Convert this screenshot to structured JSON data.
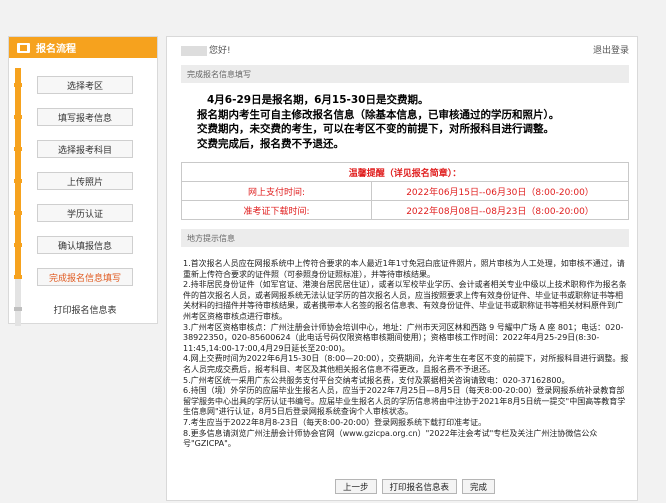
{
  "sidebar": {
    "title": "报名流程",
    "steps": [
      {
        "label": "选择考区"
      },
      {
        "label": "填写报考信息"
      },
      {
        "label": "选择报考科目"
      },
      {
        "label": "上传照片"
      },
      {
        "label": "学历认证"
      },
      {
        "label": "确认填报信息"
      },
      {
        "label": "完成报名信息填写"
      },
      {
        "label": "打印报名信息表"
      }
    ]
  },
  "header": {
    "greeting": "您好!",
    "logout": "退出登录"
  },
  "section1": {
    "title": "完成报名信息填写"
  },
  "notice": {
    "line1": "4月6-29日是报名期，6月15-30日是交费期。",
    "line2": "报名期内考生可自主修改报名信息（除基本信息，已审核通过的学历和照片）。",
    "line3": "交费期内，未交费的考生，可以在考区不变的前提下，对所报科目进行调整。",
    "line4": "交费完成后，报名费不予退还。"
  },
  "info_table": {
    "title": "温馨提醒（详见报名简章）：",
    "rows": [
      {
        "label": "网上支付时间:",
        "value": "2022年06月15日--06月30日（8:00-20:00）"
      },
      {
        "label": "准考证下载时间:",
        "value": "2022年08月08日--08月23日（8:00-20:00）"
      }
    ]
  },
  "section2": {
    "title": "地方提示信息"
  },
  "details": [
    "1.首次报名人员应在网报系统中上传符合要求的本人最近1年1寸免冠白底证件照片，照片审核为人工处理，如审核不通过，请重新上传符合要求的证件照（可参照身份证照标准），并等待审核结果。",
    "2.持非居民身份证件（如军官证、港澳台居民居住证），或者以军校毕业学历、会计或者相关专业中级以上技术职称作为报名条件的首次报名人员，或者网报系统无法认证学历的首次报名人员，应当按照要求上传有效身份证件、毕业证书或职称证书等相关材料的扫描件并等待审核结果，或者携带本人名签的报名信息表、有效身份证件、毕业证书或职称证书等相关材料原件到广州考区资格审核点进行审核。",
    "3.广州考区资格审核点：广州注册会计师协会培训中心，地址：广州市天河区林和西路 9 号耀中广场 A 座 801；电话：020-38922350，020-85600624（此电话号码仅限资格审核期间使用）；资格审核工作时间：2022年4月25-29日(8:30-11:45,14:00-17:00,4月29日延长至20:00)。",
    "4.网上交费时间为2022年6月15-30日（8:00—20:00），交费期间，允许考生在考区不变的前提下，对所报科目进行调整。报名人员完成交费后，报考科目、考区及其他相关报名信息不得更改，且报名费不予退还。",
    "5.广州考区统一采用广东公共服务支付平台交纳考试报名费，支付及票据相关咨询请致电：020-37162800。",
    "6.持国（境）外学历的应届毕业生报名人员，应当于2022年7月25日—8月5日（每天8:00-20:00）登录网报系统补录教育部留学服务中心出具的学历认证书编号。应届毕业生报名人员的学历信息将由中注协于2021年8月5日统一提交\"中国高等教育学生信息网\"进行认证，8月5日后登录网报系统查询个人审核状态。",
    "7.考生应当于2022年8月8-23日（每天8:00-20:00）登录网报系统下载打印准考证。",
    "8.更多信息请浏览广州注册会计师协会官网（www.gzicpa.org.cn）\"2022年注会考试\"专栏及关注广州注协微信公众号\"GZICPA\"。"
  ],
  "buttons": {
    "prev": "上一步",
    "print": "打印报名信息表",
    "finish": "完成"
  }
}
